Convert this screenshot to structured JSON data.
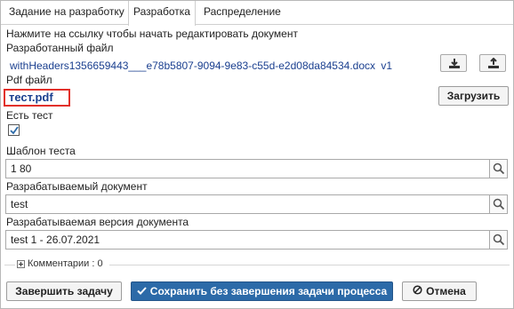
{
  "tabs": [
    {
      "label": "Задание на разработку"
    },
    {
      "label": "Разработка"
    },
    {
      "label": "Распределение"
    }
  ],
  "hint": "Нажмите на ссылку чтобы начать редактировать документ",
  "developed_file": {
    "label": "Разработанный файл",
    "file_name": "withHeaders1356659443___e78b5807-9094-9e83-c55d-e2d08da84534.docx",
    "version": "v1"
  },
  "pdf_file": {
    "label": "Pdf файл",
    "file_name": "тест.pdf",
    "upload_label": "Загрузить"
  },
  "has_test": {
    "label": "Есть тест",
    "checked": true
  },
  "test_template": {
    "label": "Шаблон теста",
    "value": "1 80"
  },
  "developed_document": {
    "label": "Разрабатываемый документ",
    "value": "test"
  },
  "document_version": {
    "label": "Разрабатываемая версия документа",
    "value": "test 1 - 26.07.2021"
  },
  "comments": {
    "label": "Комментарии : 0"
  },
  "actions": {
    "complete": "Завершить задачу",
    "save": "Сохранить без завершения задачи процесса",
    "cancel": "Отмена"
  },
  "colors": {
    "primary": "#2c6aa8",
    "highlight_border": "#e2302a",
    "link": "#1a3f8f"
  }
}
